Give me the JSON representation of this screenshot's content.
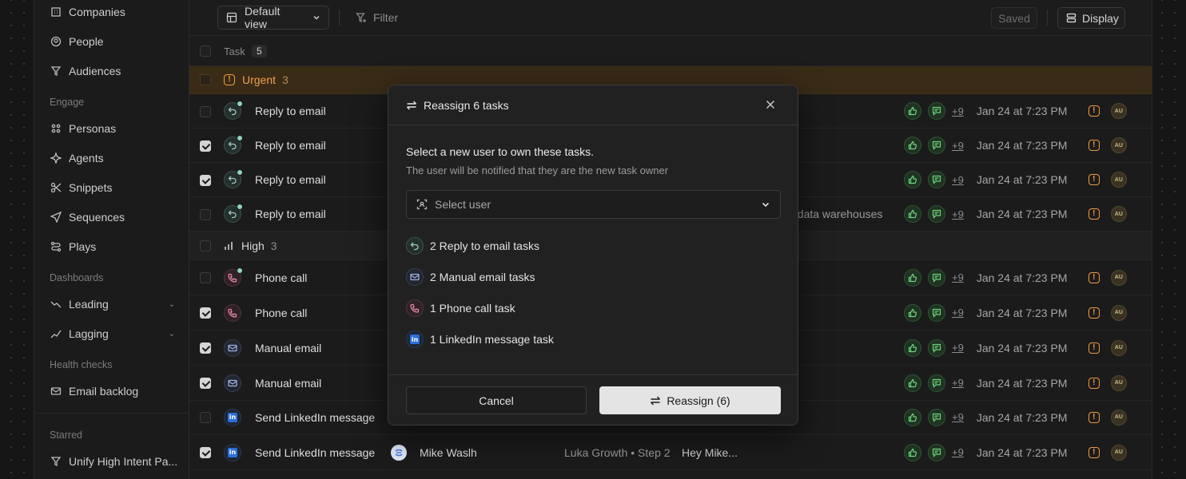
{
  "sidebar": {
    "items": [
      {
        "label": "Companies",
        "icon": "building-icon"
      },
      {
        "label": "People",
        "icon": "person-icon"
      },
      {
        "label": "Audiences",
        "icon": "filter-icon"
      }
    ],
    "engage_label": "Engage",
    "engage": [
      {
        "label": "Personas",
        "icon": "grid-icon"
      },
      {
        "label": "Agents",
        "icon": "sparkle-icon"
      },
      {
        "label": "Snippets",
        "icon": "scissors-icon"
      },
      {
        "label": "Sequences",
        "icon": "send-icon"
      },
      {
        "label": "Plays",
        "icon": "route-icon"
      }
    ],
    "dashboards_label": "Dashboards",
    "dashboards": [
      {
        "label": "Leading",
        "icon": "trend-up-icon"
      },
      {
        "label": "Lagging",
        "icon": "trend-lag-icon"
      }
    ],
    "health_label": "Health checks",
    "health": [
      {
        "label": "Email backlog",
        "icon": "mail-icon"
      }
    ],
    "starred_label": "Starred",
    "starred": [
      {
        "label": "Unify High Intent Pa...",
        "icon": "filter-icon"
      }
    ]
  },
  "toolbar": {
    "view_label": "Default view",
    "filter_label": "Filter",
    "saved_label": "Saved",
    "display_label": "Display"
  },
  "table": {
    "header_label": "Task",
    "header_count": "5",
    "groups": {
      "urgent": {
        "label": "Urgent",
        "count": "3"
      },
      "high": {
        "label": "High",
        "count": "3"
      }
    },
    "rows": [
      {
        "task": "Reply to email",
        "type": "reply",
        "checked": false,
        "badge": true,
        "date": "Jan 24 at 7:23 PM",
        "plus": "+9",
        "avatar": "AU"
      },
      {
        "task": "Reply to email",
        "type": "reply",
        "checked": true,
        "badge": true,
        "date": "Jan 24 at 7:23 PM",
        "plus": "+9",
        "avatar": "AU"
      },
      {
        "task": "Reply to email",
        "type": "reply",
        "checked": true,
        "badge": true,
        "date": "Jan 24 at 7:23 PM",
        "plus": "+9",
        "avatar": "AU"
      },
      {
        "task": "Reply to email",
        "type": "reply",
        "checked": false,
        "badge": true,
        "extra": "al data warehouses",
        "date": "Jan 24 at 7:23 PM",
        "plus": "+9",
        "avatar": "AU"
      },
      {
        "task": "Phone call",
        "type": "phone",
        "checked": false,
        "badge": true,
        "date": "Jan 24 at 7:23 PM",
        "plus": "+9",
        "avatar": "AU"
      },
      {
        "task": "Phone call",
        "type": "phone",
        "checked": true,
        "badge": false,
        "date": "Jan 24 at 7:23 PM",
        "plus": "+9",
        "avatar": "AU"
      },
      {
        "task": "Manual email",
        "type": "mail",
        "checked": true,
        "badge": false,
        "date": "Jan 24 at 7:23 PM",
        "plus": "+9",
        "avatar": "AU"
      },
      {
        "task": "Manual email",
        "type": "mail",
        "checked": true,
        "badge": false,
        "date": "Jan 24 at 7:23 PM",
        "plus": "+9",
        "avatar": "AU"
      },
      {
        "task": "Send LinkedIn message",
        "type": "li",
        "checked": false,
        "badge": false,
        "date": "Jan 24 at 7:23 PM",
        "plus": "+9",
        "avatar": "AU"
      },
      {
        "task": "Send LinkedIn message",
        "type": "li",
        "checked": true,
        "badge": false,
        "person": "Mike Waslh",
        "sequence": "Luka Growth • Step 2",
        "preview": "Hey Mike...",
        "date": "Jan 24 at 7:23 PM",
        "plus": "+9",
        "avatar": "AU"
      }
    ],
    "li_glyph": "in"
  },
  "modal": {
    "title": "Reassign 6 tasks",
    "heading": "Select a new user to own these tasks.",
    "subheading": "The user will be notified that they are the new task owner",
    "select_placeholder": "Select user",
    "summary": [
      {
        "label": "2 Reply to email tasks",
        "type": "reply"
      },
      {
        "label": "2 Manual email tasks",
        "type": "mail"
      },
      {
        "label": "1 Phone call task",
        "type": "phone"
      },
      {
        "label": "1 LinkedIn message task",
        "type": "li"
      }
    ],
    "cancel_label": "Cancel",
    "reassign_label": "Reassign (6)"
  },
  "colors": {
    "accent_orange": "#f09a3e",
    "urgent_bg": "#3a2b17",
    "green": "#6ed37a"
  }
}
